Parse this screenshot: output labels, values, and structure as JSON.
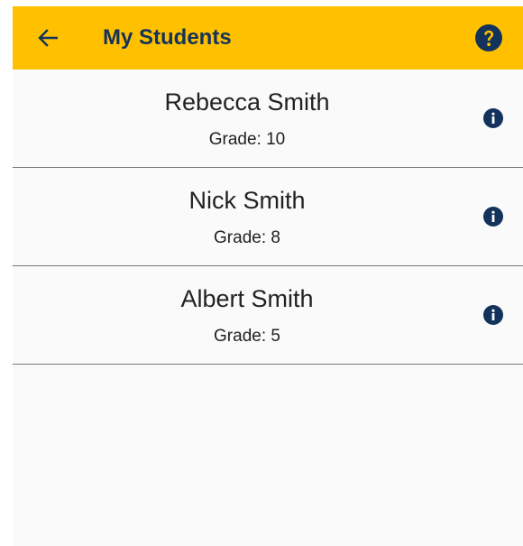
{
  "app_bar": {
    "title": "My Students",
    "back_icon": "arrow-left-icon",
    "help_icon": "question-circle-icon",
    "background_color": "#ffc000",
    "title_color": "#13335c"
  },
  "students": [
    {
      "name": "Rebecca Smith",
      "grade": "Grade: 10"
    },
    {
      "name": "Nick Smith",
      "grade": "Grade: 8"
    },
    {
      "name": "Albert Smith",
      "grade": "Grade: 5"
    }
  ],
  "row_icon": "info-circle-icon",
  "icon_color": "#13335c"
}
